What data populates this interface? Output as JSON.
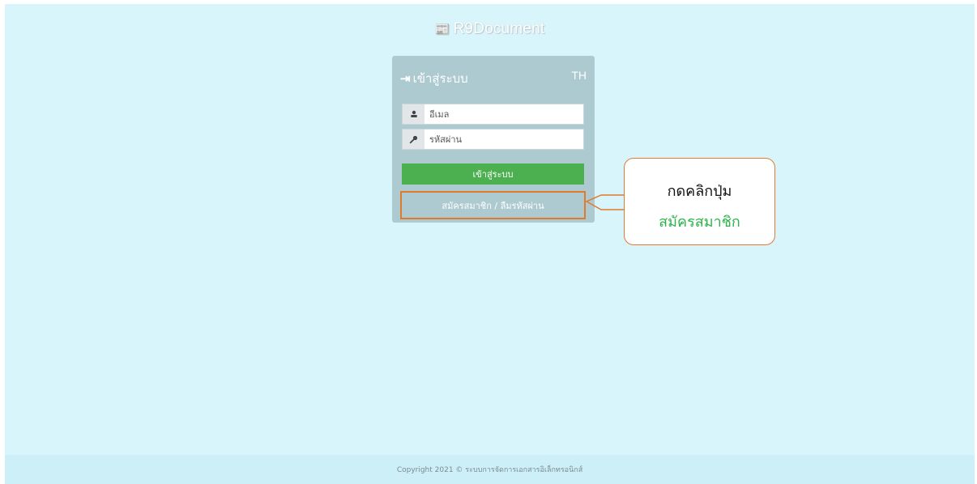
{
  "app": {
    "brand_icon": "📰",
    "brand_name": "R9Document"
  },
  "login": {
    "icon": "⇥",
    "title": "เข้าสู่ระบบ",
    "lang": "TH",
    "email_placeholder": "อีเมล",
    "password_placeholder": "รหัสผ่าน",
    "email_icon": "user-icon",
    "password_icon": "key-icon",
    "submit_label": "เข้าสู่ระบบ",
    "register_label": "สมัครสมาชิก / ลืมรหัสผ่าน"
  },
  "callout": {
    "line1": "กดคลิกปุ่ม",
    "line2": "สมัครสมาชิก"
  },
  "footer": {
    "copyright": "Copyright 2021 © ระบบการจัดการเอกสารอิเล็กทรอนิกส์"
  },
  "colors": {
    "background": "#d8f5fb",
    "panel": "#adcad1",
    "login_button": "#4caf50",
    "highlight": "#e07a2e",
    "callout_accent": "#2db34a"
  }
}
